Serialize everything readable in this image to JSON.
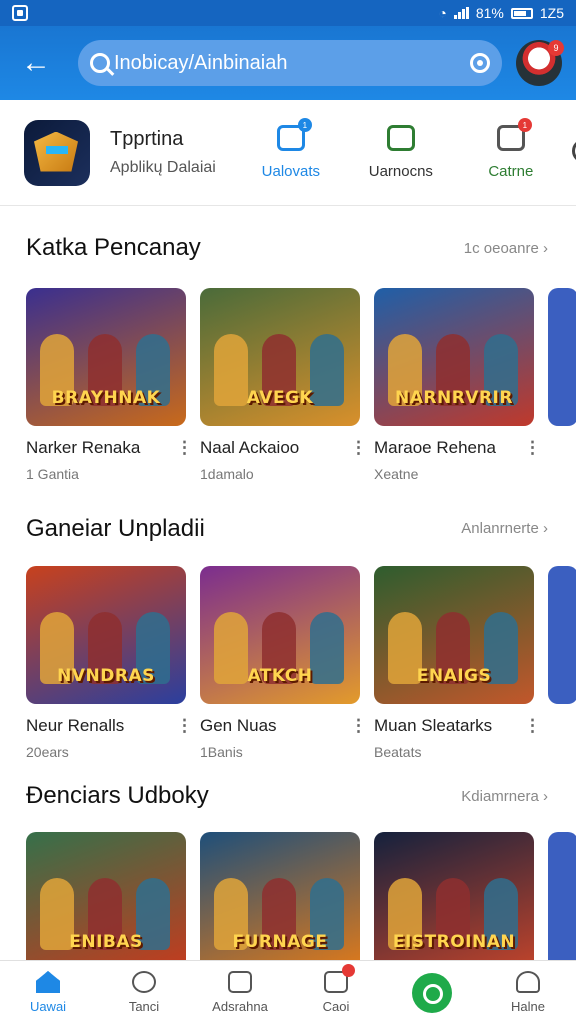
{
  "status": {
    "time": "1Z5",
    "battery": "81%"
  },
  "header": {
    "search_query": "Inobicay/Ainbinaiah"
  },
  "app": {
    "name": "Tpprtina",
    "subtitle": "Apblikų Dalaiai"
  },
  "tabs": [
    {
      "label": "Ualovats",
      "icon": "update-icon"
    },
    {
      "label": "Uarnocns",
      "icon": "news-icon"
    },
    {
      "label": "Catrne",
      "icon": "games-icon"
    }
  ],
  "sections": [
    {
      "title": "Katka Pencanay",
      "see_more": "1c oeoanre",
      "cards": [
        {
          "title": "Narker Renaka",
          "sub": "1 Gantia",
          "logo": "BRAYHNAK",
          "colors": [
            "#3a2f8f",
            "#c96a1a"
          ]
        },
        {
          "title": "Naal Ackaioo",
          "sub": "1damalo",
          "logo": "AVEGK",
          "colors": [
            "#4a6b3a",
            "#d9902b"
          ]
        },
        {
          "title": "Maraoe Rehena",
          "sub": "Xeatne",
          "logo": "NARNRVRIR",
          "colors": [
            "#1f5fa8",
            "#c0392b"
          ]
        }
      ]
    },
    {
      "title": "Ganeiar Unpladii",
      "see_more": "Anlanrnerte",
      "cards": [
        {
          "title": "Neur Renalls",
          "sub": "20ears",
          "logo": "NVNDRAS",
          "colors": [
            "#c8411d",
            "#2b3f9e"
          ]
        },
        {
          "title": "Gen Nuas",
          "sub": "1Banis",
          "logo": "ATKCH",
          "colors": [
            "#7b2d8f",
            "#e39b2b"
          ]
        },
        {
          "title": "Muan Sleatarks",
          "sub": "Beatats",
          "logo": "ENAIGS",
          "colors": [
            "#2e5d2e",
            "#c2572b"
          ]
        }
      ]
    },
    {
      "title": "Đenciars Udboky",
      "see_more": "Kdiamrnera",
      "cards": [
        {
          "title": "",
          "sub": "",
          "logo": "ENIBAS",
          "colors": [
            "#35704a",
            "#c53b1e"
          ]
        },
        {
          "title": "",
          "sub": "",
          "logo": "FURNAGE",
          "colors": [
            "#1e4f7a",
            "#e07a1a"
          ]
        },
        {
          "title": "",
          "sub": "",
          "logo": "EISTROINAN",
          "colors": [
            "#14213d",
            "#c2442b"
          ]
        }
      ]
    }
  ],
  "bottom_nav": [
    {
      "label": "Uawai",
      "icon": "home-icon"
    },
    {
      "label": "Tanci",
      "icon": "search-icon"
    },
    {
      "label": "Adsrahna",
      "icon": "apps-icon"
    },
    {
      "label": "Caoi",
      "icon": "games-icon"
    },
    {
      "label": "",
      "icon": "play-icon"
    },
    {
      "label": "Halne",
      "icon": "profile-icon"
    }
  ]
}
